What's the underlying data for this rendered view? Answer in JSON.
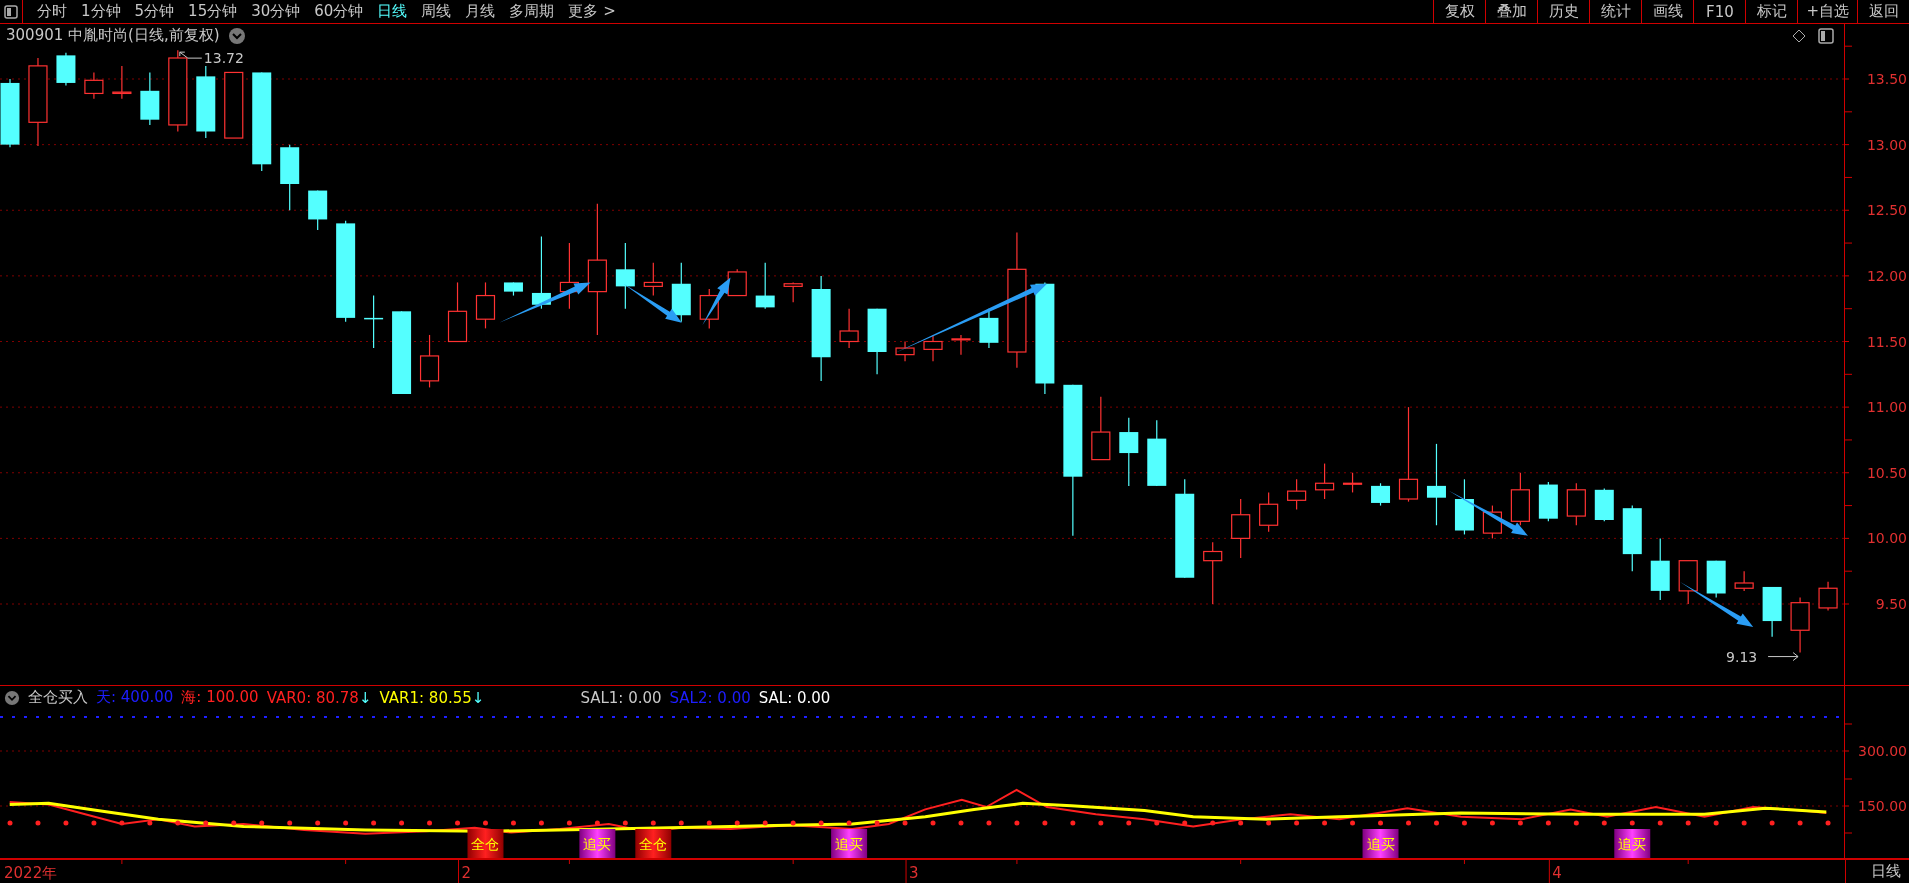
{
  "toolbar": {
    "periods": [
      {
        "label": "分时",
        "selected": false
      },
      {
        "label": "1分钟",
        "selected": false
      },
      {
        "label": "5分钟",
        "selected": false
      },
      {
        "label": "15分钟",
        "selected": false
      },
      {
        "label": "30分钟",
        "selected": false
      },
      {
        "label": "60分钟",
        "selected": false
      },
      {
        "label": "日线",
        "selected": true
      },
      {
        "label": "周线",
        "selected": false
      },
      {
        "label": "月线",
        "selected": false
      },
      {
        "label": "多周期",
        "selected": false
      },
      {
        "label": "更多 >",
        "selected": false
      }
    ],
    "tools": [
      "复权",
      "叠加",
      "历史",
      "统计",
      "画线",
      "F10",
      "标记",
      "+自选",
      "返回"
    ]
  },
  "chart": {
    "title": "300901 中胤时尚(日线,前复权)",
    "high_marker": "13.72",
    "low_marker": "9.13",
    "price_axis": [
      "13.50",
      "13.00",
      "12.50",
      "12.00",
      "11.50",
      "11.00",
      "10.50",
      "10.00",
      "9.50"
    ]
  },
  "indicator": {
    "name": "全仓买入",
    "values": [
      {
        "text": "天: 400.00",
        "color": "#1e1eff"
      },
      {
        "text": "海: 100.00",
        "color": "#ff2020"
      },
      {
        "text": "VAR0: 80.78",
        "color": "#ff2020",
        "trend": "↓"
      },
      {
        "text": "VAR1: 80.55",
        "color": "#ffff00",
        "trend": "↓"
      },
      {
        "text": "SAL1: 0.00",
        "color": "#c8c8c8"
      },
      {
        "text": "SAL2: 0.00",
        "color": "#1e1eff"
      },
      {
        "text": "SAL: 0.00",
        "color": "#ffffff"
      }
    ],
    "axis": [
      "300.00",
      "150.00"
    ],
    "signals": [
      {
        "kind": "full",
        "label": "全仓"
      },
      {
        "kind": "chase",
        "label": "追买"
      },
      {
        "kind": "full",
        "label": "全仓"
      },
      {
        "kind": "chase",
        "label": "追买"
      },
      {
        "kind": "chase",
        "label": "追买"
      },
      {
        "kind": "chase",
        "label": "追买"
      }
    ]
  },
  "date_axis": {
    "labels": [
      "2022年",
      "2",
      "3",
      "4"
    ],
    "period": "日线"
  }
}
